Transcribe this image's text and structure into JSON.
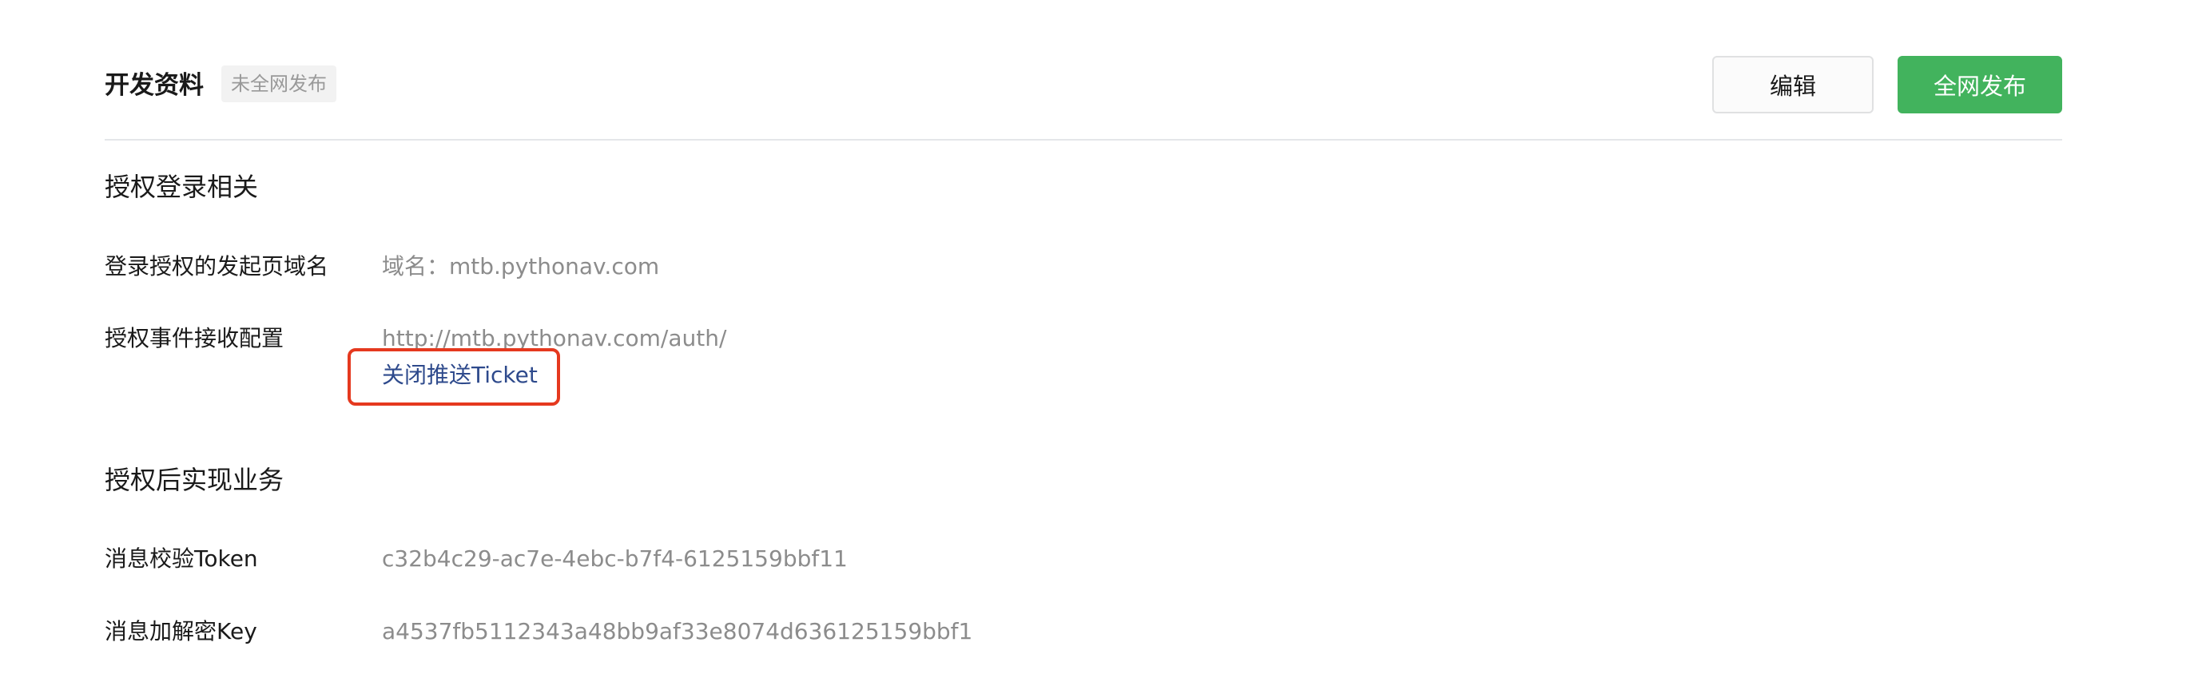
{
  "header": {
    "title": "开发资料",
    "badge": "未全网发布",
    "edit_label": "编辑",
    "publish_label": "全网发布"
  },
  "auth_login": {
    "title": "授权登录相关",
    "domain_label": "登录授权的发起页域名",
    "domain_value": "域名：mtb.pythonav.com",
    "event_label": "授权事件接收配置",
    "event_value": "http://mtb.pythonav.com/auth/",
    "close_ticket_label": "关闭推送Ticket"
  },
  "business": {
    "title": "授权后实现业务",
    "token_label": "消息校验Token",
    "token_value": "c32b4c29-ac7e-4ebc-b7f4-6125159bbf11",
    "key_label": "消息加解密Key",
    "key_value": "a4537fb5112343a48bb9af33e8074d636125159bbf1"
  },
  "colors": {
    "primary_green": "#42b35d",
    "link_blue": "#2e4a8c",
    "highlight_red": "#e5391f"
  }
}
